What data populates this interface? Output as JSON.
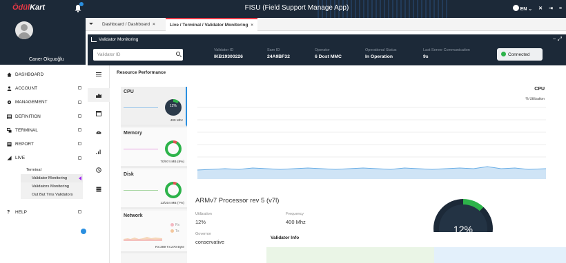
{
  "brand": {
    "logo_part1": "Ödül",
    "logo_part2": "Kart"
  },
  "header": {
    "title": "FISU (Field Support Manage App)",
    "lang": "EN"
  },
  "user": {
    "name": "Caner Okçuoğlu"
  },
  "sidebar": {
    "items": [
      {
        "label": "DASHBOARD",
        "icon": "home-icon"
      },
      {
        "label": "ACCOUNT",
        "icon": "user-icon"
      },
      {
        "label": "MANAGEMENT",
        "icon": "gear-icon"
      },
      {
        "label": "DEFINITION",
        "icon": "list-icon"
      },
      {
        "label": "TERMINAL",
        "icon": "terminal-icon"
      },
      {
        "label": "REPORT",
        "icon": "report-icon"
      },
      {
        "label": "LIVE",
        "icon": "signal-icon"
      }
    ],
    "live_submenu": {
      "head": "Terminal",
      "items": [
        "Validator Monitoring",
        "Validators Monitoring",
        "Out But Trns Validators"
      ]
    },
    "help": "HELP"
  },
  "tabs": [
    {
      "label": "Dashboard / Dashboard",
      "active": false
    },
    {
      "label": "Live / Terminal / Validator Monitoring",
      "active": true
    }
  ],
  "panel": {
    "title": "Validator Monitoring",
    "search_placeholder": "Validator ID",
    "info": [
      {
        "label": "Validator ID",
        "value": "IKB19300226"
      },
      {
        "label": "Sam ID",
        "value": "24A9BF32"
      },
      {
        "label": "Operator",
        "value": "6 Dost MMC"
      },
      {
        "label": "Operational Status",
        "value": "In Operation"
      },
      {
        "label": "Last Server Communication",
        "value": "9s"
      }
    ],
    "status": "Connected"
  },
  "content": {
    "section_title": "Resource Performance",
    "resources": [
      {
        "name": "CPU",
        "ring_text": "12%",
        "foot": "400 Mhz",
        "percent": 12
      },
      {
        "name": "Memory",
        "foot": "70/974 MB (8%)",
        "percent": 8
      },
      {
        "name": "Disk",
        "foot": "13/204 MB (7%)",
        "percent": 7
      },
      {
        "name": "Network",
        "foot": "Rx:389 Tx:270 Byte",
        "legend_rx": "Rx",
        "legend_tx": "Tx"
      }
    ],
    "chart_title": "CPU",
    "chart_sub": "% Utilization",
    "processor": "ARMv7 Processor rev 5 (v7l)",
    "stats": [
      {
        "label": "Utilization",
        "value": "12%"
      },
      {
        "label": "Frequency",
        "value": "400 Mhz"
      },
      {
        "label": "Governor",
        "value": "conservative"
      }
    ],
    "big_ring_text": "12%",
    "validator_info_title": "Validator Info"
  },
  "colors": {
    "dark": "#1c2938",
    "accent_blue": "#2a8fe0",
    "green": "#2db34a",
    "brand_red": "#e63946"
  }
}
